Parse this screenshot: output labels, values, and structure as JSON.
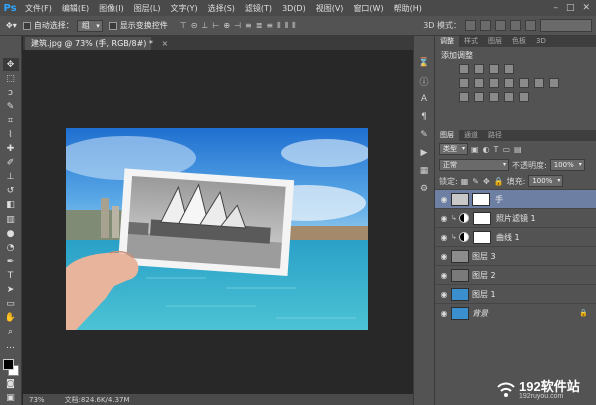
{
  "app": {
    "logo": "Ps"
  },
  "menu": [
    "文件(F)",
    "编辑(E)",
    "图像(I)",
    "图层(L)",
    "文字(Y)",
    "选择(S)",
    "滤镜(T)",
    "3D(D)",
    "视图(V)",
    "窗口(W)",
    "帮助(H)"
  ],
  "options": {
    "auto_select_label": "自动选择：",
    "auto_select_value": "组",
    "show_transform_label": "显示变换控件",
    "mode3d_label": "3D 模式："
  },
  "document": {
    "tab_title": "建筑.jpg @ 73% (手, RGB/8#) *",
    "close": "×",
    "zoom": "73%",
    "doc_size": "文档:824.6K/4.37M"
  },
  "adjust_panel": {
    "tabs": [
      "调整",
      "样式",
      "图层",
      "色板",
      "3D"
    ],
    "title": "添加调整"
  },
  "layers_panel": {
    "tabs": [
      "图层",
      "通道",
      "路径"
    ],
    "kind_filter": "类型",
    "blend_mode": "正常",
    "opacity_label": "不透明度:",
    "opacity_value": "100%",
    "lock_label": "锁定:",
    "fill_label": "填充:",
    "fill_value": "100%",
    "layers": [
      {
        "name": "手",
        "selected": true
      },
      {
        "name": "照片滤镜 1",
        "adjustment": true
      },
      {
        "name": "曲线 1",
        "adjustment": true
      },
      {
        "name": "图层 3"
      },
      {
        "name": "图层 2"
      },
      {
        "name": "图层 1"
      },
      {
        "name": "背景",
        "locked": true
      }
    ]
  },
  "watermark": {
    "main": "192软件站",
    "sub": "192ruyou.com"
  },
  "colors": {
    "accent": "#2fa4ff",
    "panel": "#535353",
    "workspace": "#282828",
    "selection": "#6d7fa3"
  }
}
